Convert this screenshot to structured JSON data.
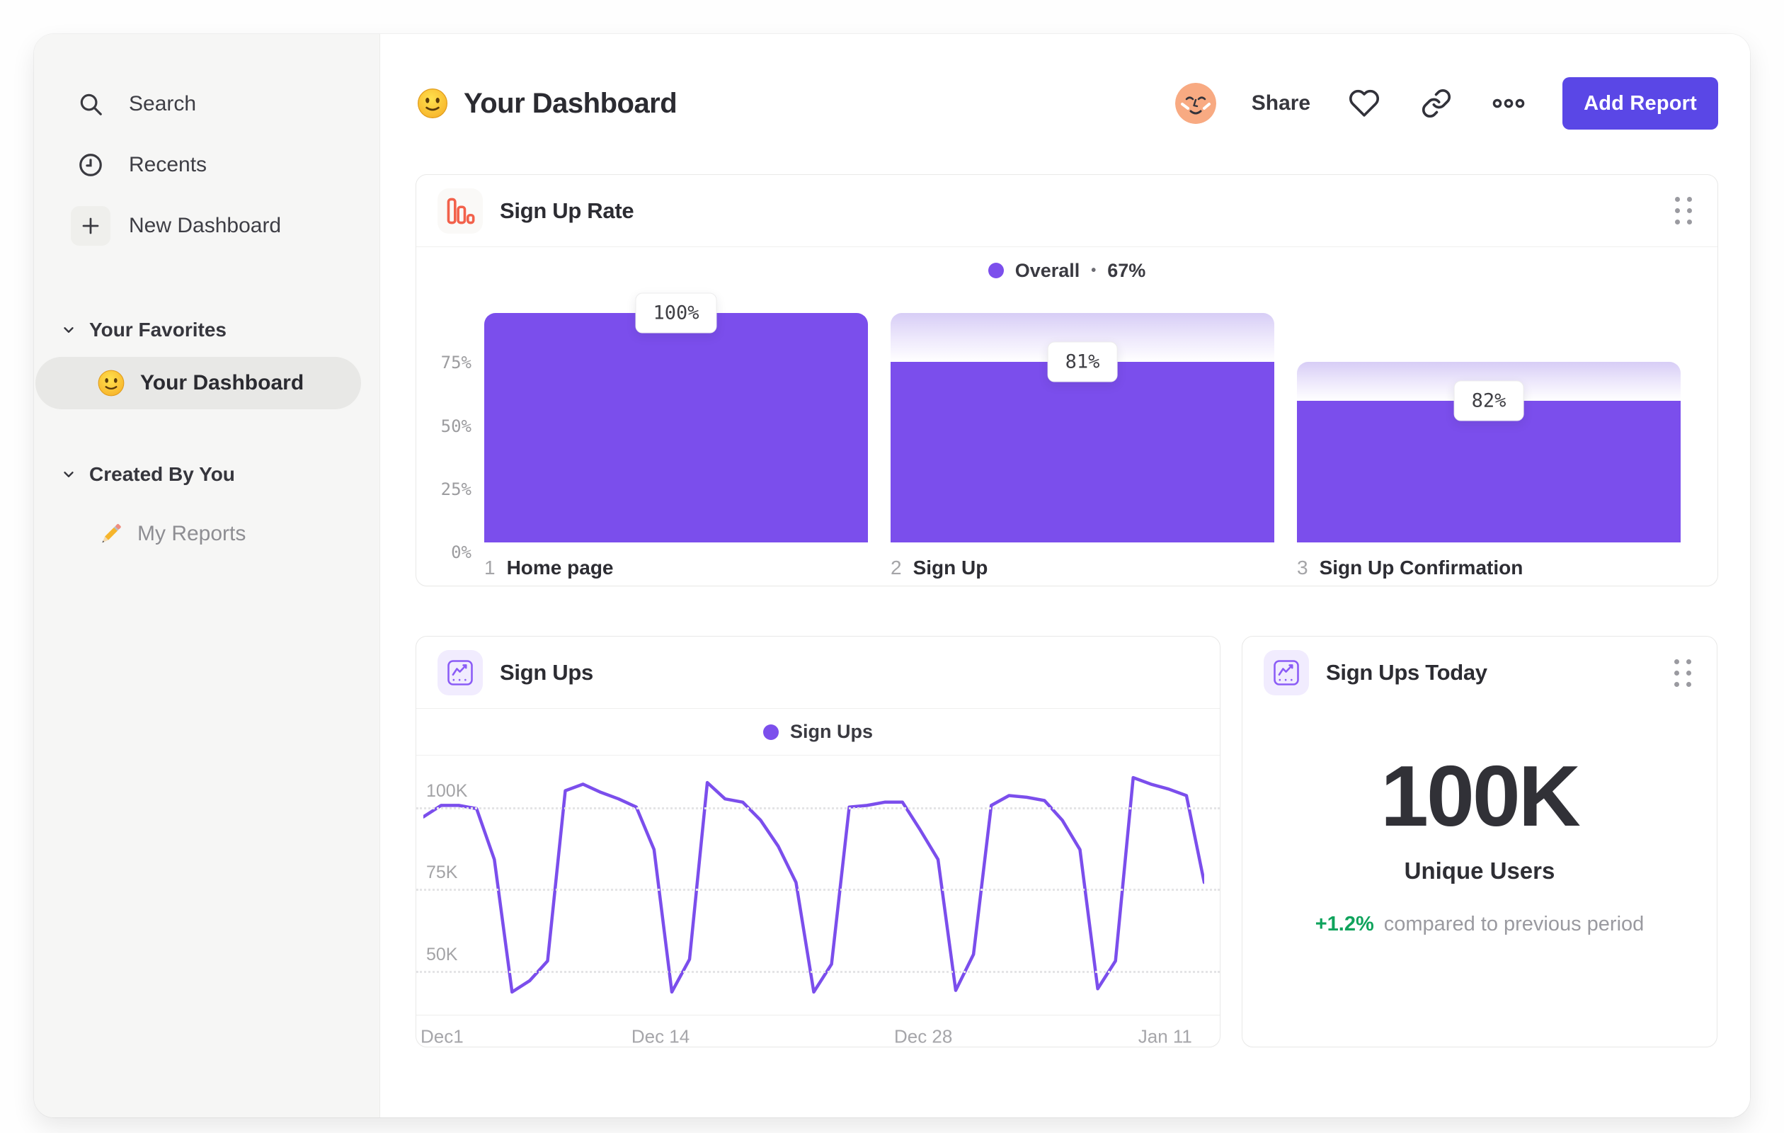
{
  "colors": {
    "purple": "#7b4eec",
    "button_purple": "#5a47e6",
    "orange": "#f2614b",
    "green": "#0fa35c"
  },
  "sidebar": {
    "nav": [
      {
        "icon": "search-icon",
        "label": "Search"
      },
      {
        "icon": "clock-icon",
        "label": "Recents"
      },
      {
        "icon": "plus-icon",
        "label": "New Dashboard"
      }
    ],
    "sections": [
      {
        "title": "Your Favorites",
        "items": [
          {
            "icon": "smiley-emoji",
            "label": "Your Dashboard",
            "selected": true
          }
        ]
      },
      {
        "title": "Created By You",
        "items": [
          {
            "icon": "pencil-emoji",
            "label": "My Reports",
            "selected": false
          }
        ]
      }
    ]
  },
  "header": {
    "title": "Your Dashboard",
    "share_label": "Share",
    "add_report_label": "Add Report"
  },
  "cards": {
    "funnel": {
      "title": "Sign Up Rate",
      "legend_label": "Overall",
      "legend_separator": "•",
      "legend_value": "67%"
    },
    "line": {
      "title": "Sign Ups",
      "legend_label": "Sign Ups"
    },
    "stat": {
      "title": "Sign Ups Today",
      "value": "100K",
      "metric": "Unique Users",
      "delta": "+1.2%",
      "note": "compared to previous period"
    }
  },
  "chart_data": [
    {
      "type": "bar",
      "subtype": "funnel",
      "title": "Sign Up Rate",
      "overall_conversion": "67%",
      "steps": [
        {
          "index": "1",
          "label": "Home page",
          "conversion_from_previous": "100%"
        },
        {
          "index": "2",
          "label": "Sign Up",
          "conversion_from_previous": "81%"
        },
        {
          "index": "3",
          "label": "Sign Up Confirmation",
          "conversion_from_previous": "82%"
        }
      ],
      "values_pct": [
        100,
        81,
        82
      ],
      "drawn_heights_pct": [
        94,
        74,
        58
      ],
      "y_ticks": [
        "75%",
        "50%",
        "25%",
        "0%"
      ],
      "y_tick_pos_pct": [
        23,
        45.5,
        68,
        90.5
      ],
      "bar_color": "#7b4eec",
      "grid": false,
      "legend_position": "top-center"
    },
    {
      "type": "line",
      "title": "Sign Ups",
      "series": [
        {
          "name": "Sign Ups",
          "values_thousands": [
            97,
            100.5,
            100.5,
            99.5,
            84,
            43.5,
            47,
            53,
            105,
            107,
            104.5,
            102.5,
            100,
            87,
            43.5,
            53.5,
            107.5,
            102.5,
            101.5,
            96,
            88,
            77,
            43.5,
            52,
            100,
            100.5,
            101.5,
            101.5,
            93,
            84,
            44,
            55,
            100.5,
            103.5,
            103,
            102,
            96,
            87,
            44.5,
            53,
            109,
            107,
            105.5,
            103.5,
            77
          ]
        }
      ],
      "x_ticks": [
        {
          "label": "Dec1",
          "pos_pct": 3.2
        },
        {
          "label": "Dec 14",
          "pos_pct": 30.4
        },
        {
          "label": "Dec 28",
          "pos_pct": 63.1
        },
        {
          "label": "Jan 11",
          "pos_pct": 93.2
        }
      ],
      "y_ticks": [
        {
          "label": "100K",
          "value": 100
        },
        {
          "label": "75K",
          "value": 75
        },
        {
          "label": "50K",
          "value": 50
        }
      ],
      "ylim": [
        37,
        114
      ],
      "line_color": "#7b4eec",
      "grid": "horizontal-dotted",
      "legend_position": "top-center"
    }
  ]
}
